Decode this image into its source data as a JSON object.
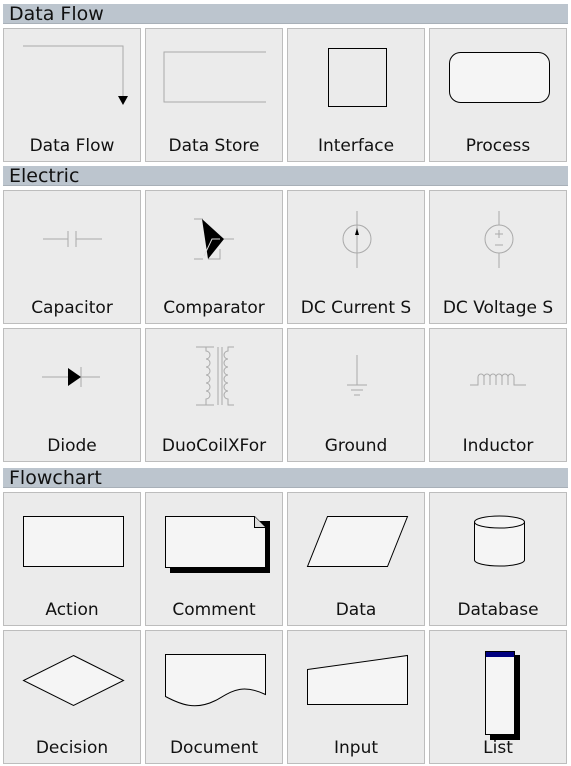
{
  "sections": [
    {
      "title": "Data Flow",
      "items": [
        {
          "label": "Data Flow",
          "icon": "data-flow-arrow-icon"
        },
        {
          "label": "Data Store",
          "icon": "data-store-icon"
        },
        {
          "label": "Interface",
          "icon": "interface-square-icon"
        },
        {
          "label": "Process",
          "icon": "process-rounded-rect-icon"
        }
      ]
    },
    {
      "title": "Electric",
      "items": [
        {
          "label": "Capacitor",
          "icon": "capacitor-icon"
        },
        {
          "label": "Comparator",
          "icon": "comparator-icon"
        },
        {
          "label": "DC Current S",
          "icon": "dc-current-source-icon"
        },
        {
          "label": "DC Voltage S",
          "icon": "dc-voltage-source-icon"
        },
        {
          "label": "Diode",
          "icon": "diode-icon"
        },
        {
          "label": "DuoCoilXFor",
          "icon": "transformer-icon"
        },
        {
          "label": "Ground",
          "icon": "ground-icon"
        },
        {
          "label": "Inductor",
          "icon": "inductor-icon"
        }
      ]
    },
    {
      "title": "Flowchart",
      "items": [
        {
          "label": "Action",
          "icon": "action-rect-icon"
        },
        {
          "label": "Comment",
          "icon": "comment-icon"
        },
        {
          "label": "Data",
          "icon": "data-parallelogram-icon"
        },
        {
          "label": "Database",
          "icon": "database-cylinder-icon"
        },
        {
          "label": "Decision",
          "icon": "decision-diamond-icon"
        },
        {
          "label": "Document",
          "icon": "document-icon"
        },
        {
          "label": "Input",
          "icon": "input-icon"
        },
        {
          "label": "List",
          "icon": "list-icon"
        }
      ]
    }
  ],
  "colors": {
    "header_bg": "#bcc5ce",
    "tile_bg": "#ebebeb",
    "list_header": "#000080"
  }
}
